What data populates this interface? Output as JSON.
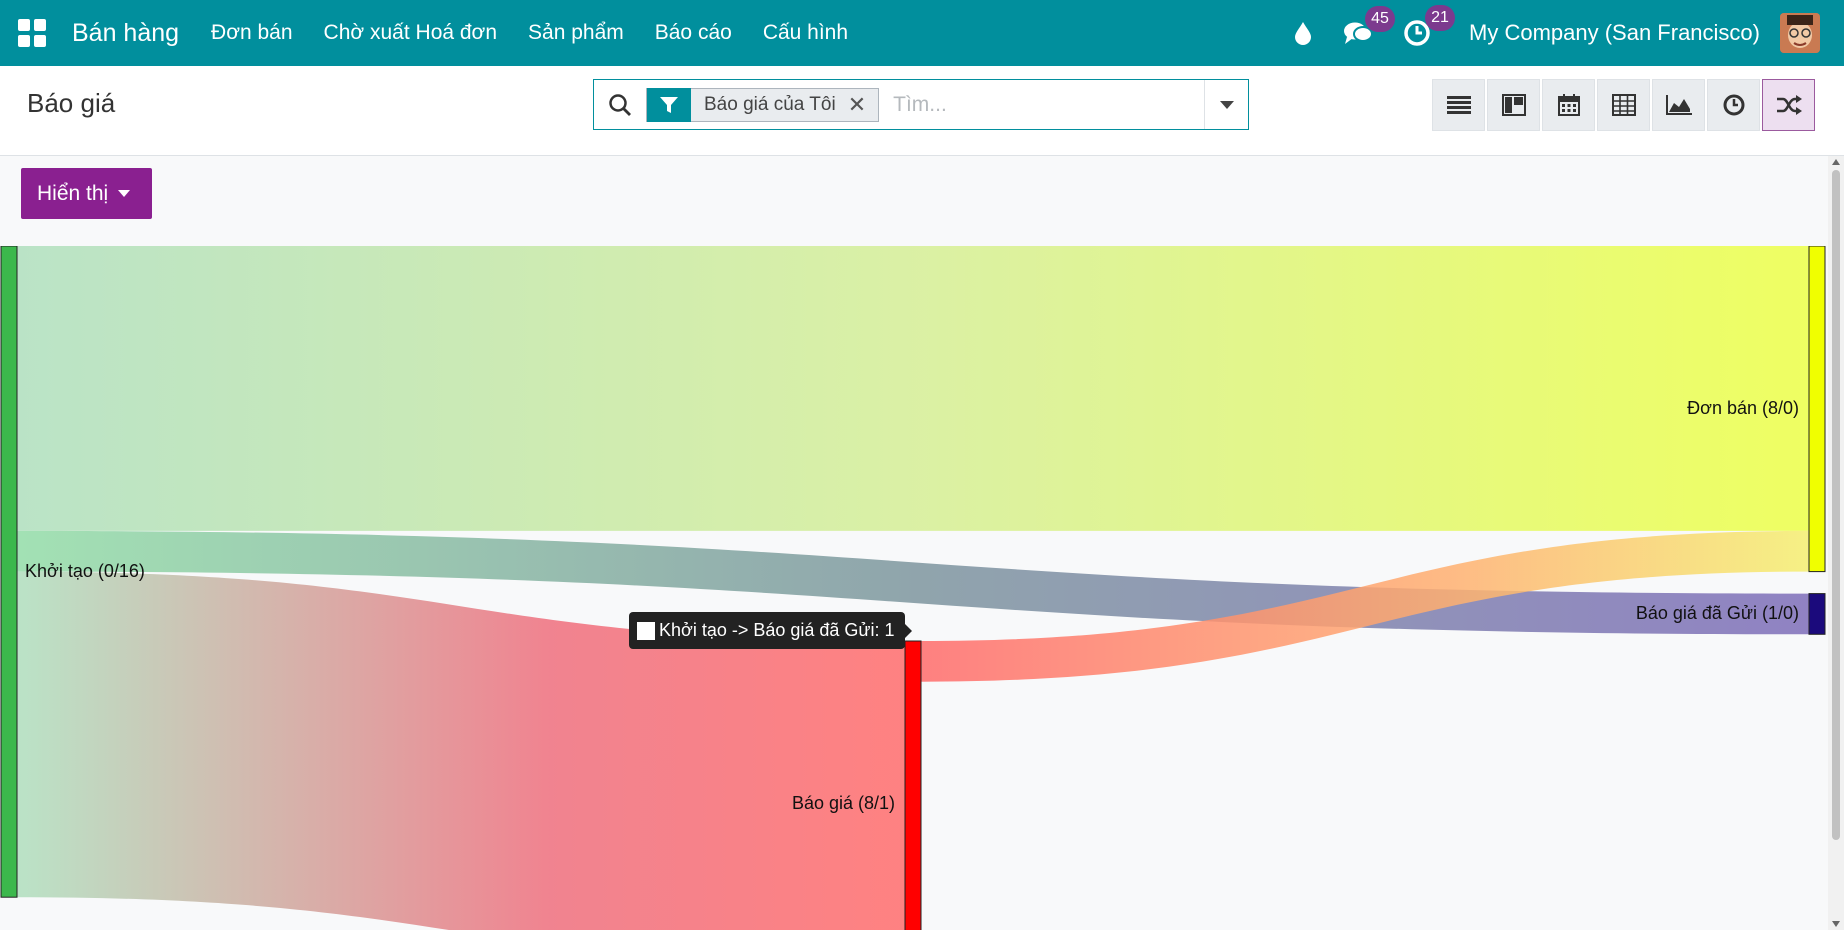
{
  "navbar": {
    "app_title": "Bán hàng",
    "menu": [
      "Đơn bán",
      "Chờ xuất Hoá đơn",
      "Sản phẩm",
      "Báo cáo",
      "Cấu hình"
    ],
    "messages_count": "45",
    "activities_count": "21",
    "company": "My Company (San Francisco)"
  },
  "control_panel": {
    "breadcrumb": "Báo giá",
    "facet_label": "Báo giá của Tôi",
    "search_placeholder": "Tìm..."
  },
  "display_button": "Hiển thị",
  "chart_data": {
    "type": "sankey",
    "nodes": [
      {
        "id": "khoi_tao",
        "label": "Khởi tạo (0/16)",
        "color": "#3cb84c"
      },
      {
        "id": "bao_gia",
        "label": "Báo giá (8/1)",
        "color": "#ff0000"
      },
      {
        "id": "don_ban",
        "label": "Đơn bán (8/0)",
        "color": "#f0ff00"
      },
      {
        "id": "bao_gia_da_gui",
        "label": "Báo giá đã Gửi (1/0)",
        "color": "#1b0a7c"
      }
    ],
    "links": [
      {
        "source": "khoi_tao",
        "target": "don_ban",
        "value": 7
      },
      {
        "source": "khoi_tao",
        "target": "bao_gia_da_gui",
        "value": 1
      },
      {
        "source": "khoi_tao",
        "target": "bao_gia",
        "value": 8
      },
      {
        "source": "bao_gia",
        "target": "don_ban",
        "value": 1
      }
    ],
    "tooltip": "Khởi tạo -> Báo giá đã Gửi: 1"
  }
}
